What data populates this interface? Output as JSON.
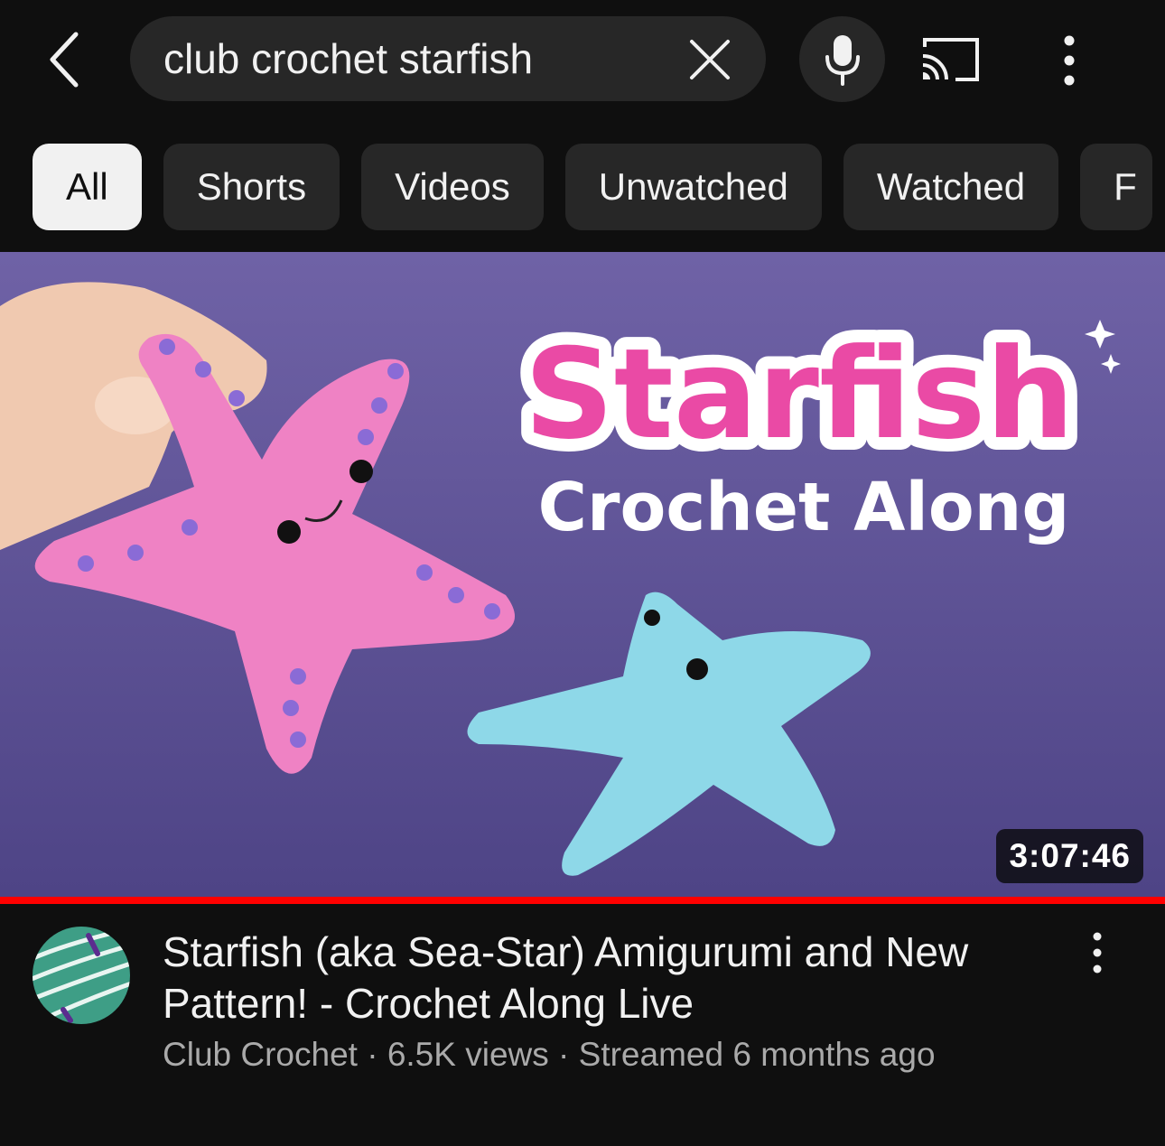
{
  "search": {
    "query": "club crochet starfish"
  },
  "filters": [
    "All",
    "Shorts",
    "Videos",
    "Unwatched",
    "Watched",
    "F"
  ],
  "video": {
    "thumbnail_title": "Starfish",
    "thumbnail_subtitle": "Crochet Along",
    "duration": "3:07:46",
    "progress": 1.0,
    "title": "Starfish (aka Sea-Star) Amigurumi and New Pattern! - Crochet Along Live",
    "channel": "Club Crochet",
    "views": "6.5K views",
    "separator": " · ",
    "streamed": "Streamed 6 months ago"
  },
  "colors": {
    "background": "#0f0f0f",
    "chip": "#272727",
    "chip_active": "#f1f1f1",
    "progress": "#ff0000",
    "meta": "#aaaaaa"
  },
  "icons": {
    "back": "back-arrow-icon",
    "clear": "close-icon",
    "mic": "microphone-icon",
    "cast": "cast-icon",
    "more": "more-vertical-icon"
  }
}
